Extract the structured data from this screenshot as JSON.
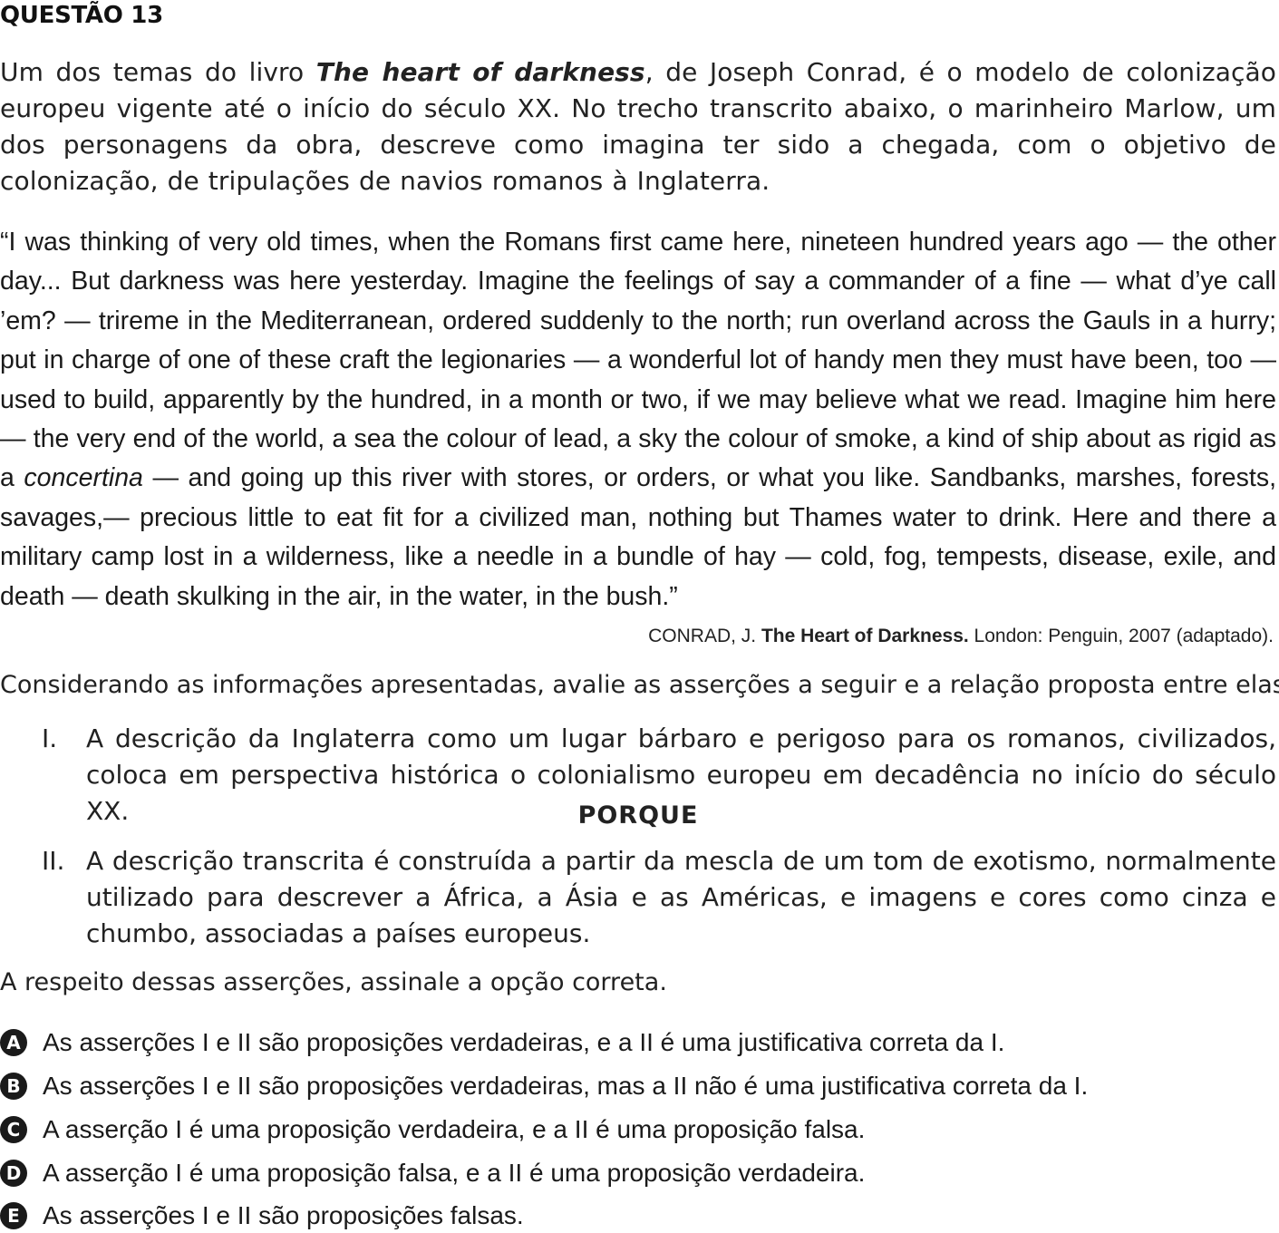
{
  "title": "QUESTÃO 13",
  "intro": {
    "before": "Um dos temas do livro ",
    "book": "The heart of darkness",
    "after": ", de Joseph Conrad, é o modelo de colonização europeu vigente até o início do século XX. No trecho transcrito abaixo, o marinheiro Marlow, um dos personagens da obra, descreve como imagina ter sido a chegada, com o objetivo de colonização, de tripulações de navios romanos à Inglaterra."
  },
  "quote": {
    "before": "“I was thinking of very old times, when the Romans first came here, nineteen hundred years ago — the other day... But darkness was here yesterday. Imagine the feelings of say a commander of a fine — what d’ye call ’em? — trireme in the Mediterranean, ordered suddenly to the north; run overland across the Gauls in a hurry; put in charge of one of these craft the legionaries — a wonderful lot of handy men they must have been, too — used to build, apparently by the hundred, in a month or two, if we may believe what we read. Imagine him here — the very end of the world, a sea the colour of lead, a sky the colour of smoke, a kind of ship about as rigid as a ",
    "italic": "concertina",
    "after": " — and going up this river with stores, or orders, or what you like. Sandbanks, marshes, forests, savages,— precious little to eat fit for a civilized man, nothing but Thames water to drink. Here and there a military camp lost in a wilderness, like a needle in a bundle of hay — cold, fog, tempests, disease, exile, and death — death skulking in the air, in the water, in the bush.”"
  },
  "source": {
    "author": "CONRAD, J. ",
    "work": "The Heart of Darkness.",
    "rest": " London: Penguin, 2007 (adaptado)."
  },
  "consider": "Considerando as informações apresentadas, avalie as asserções a seguir e a relação proposta entre elas.",
  "assertions": [
    {
      "num": "I.",
      "text": "A descrição da Inglaterra como um lugar bárbaro e perigoso para os romanos, civilizados, coloca em perspectiva histórica o colonialismo europeu em decadência no início do século XX."
    },
    {
      "num": "II.",
      "text": "A descrição transcrita é construída a partir da mescla de um tom de exotismo, normalmente utilizado para descrever a África, a Ásia e as Américas, e imagens e cores como cinza e chumbo, associadas a países europeus."
    }
  ],
  "porque": "PORQUE",
  "question": "A respeito dessas asserções, assinale a opção correta.",
  "options": [
    {
      "letter": "A",
      "text": "As asserções I e II são proposições verdadeiras, e a II é uma justificativa correta da I."
    },
    {
      "letter": "B",
      "text": "As asserções I e II são proposições verdadeiras, mas a II não é uma justificativa correta da I."
    },
    {
      "letter": "C",
      "text": "A asserção I é uma proposição verdadeira, e a II é uma proposição falsa."
    },
    {
      "letter": "D",
      "text": "A asserção I é uma proposição falsa, e a II é uma proposição verdadeira."
    },
    {
      "letter": "E",
      "text": "As asserções I e II são proposições falsas."
    }
  ]
}
